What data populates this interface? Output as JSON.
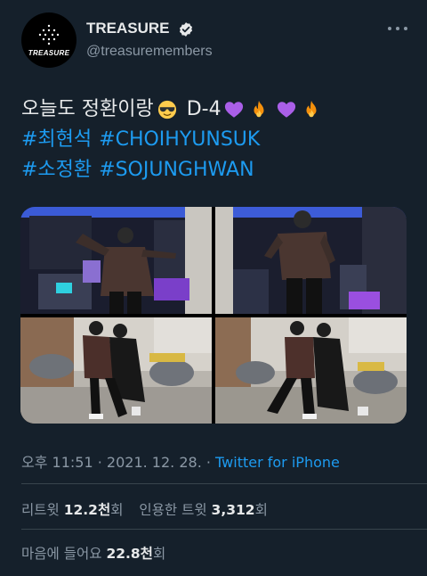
{
  "account": {
    "display_name": "TREASURE",
    "handle": "@treasuremembers",
    "avatar_text": "TREASURE"
  },
  "tweet": {
    "line1_text": "오늘도 정환이랑",
    "line1_suffix": "D-4",
    "hashtag1": "#최현석",
    "hashtag2": "#CHOIHYUNSUK",
    "hashtag3": "#소정환",
    "hashtag4": "#SOJUNGHWAN",
    "emojis": [
      "smiling-face-with-sunglasses",
      "purple-heart",
      "fire",
      "purple-heart",
      "fire"
    ]
  },
  "meta": {
    "time": "오후 11:51",
    "separator": " · ",
    "date": "2021. 12. 28.",
    "app": "Twitter for iPhone"
  },
  "stats": {
    "retweets_label": "리트윗",
    "retweets_value": "12.2천",
    "retweets_unit": "회",
    "quotes_label": "인용한 트윗",
    "quotes_value": "3,312",
    "quotes_unit": "회",
    "likes_label": "마음에 들어요",
    "likes_value": "22.8천",
    "likes_unit": "회"
  },
  "colors": {
    "background": "#15202b",
    "text": "#e7e9ea",
    "secondary": "#8b98a5",
    "accent": "#1d9bf0",
    "divider": "#38444d"
  }
}
